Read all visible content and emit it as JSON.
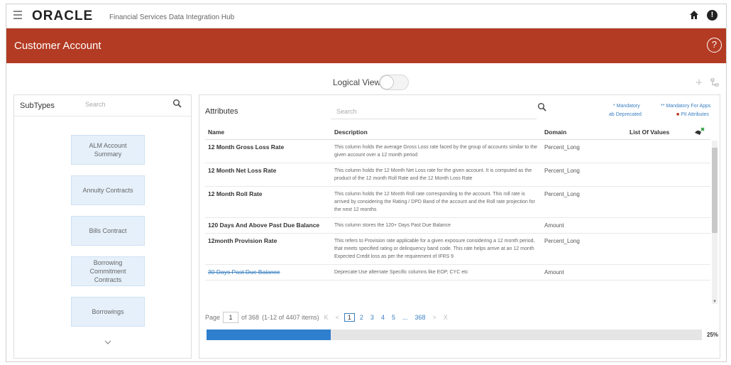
{
  "app": {
    "logo": "ORACLE",
    "product": "Financial Services Data Integration Hub",
    "page_title": "Customer Account"
  },
  "toolbar": {
    "logical_view_label": "Logical View",
    "logical_view_on": false
  },
  "subtypes": {
    "label": "SubTypes",
    "search_placeholder": "Search",
    "items": [
      "ALM Account Summary",
      "Annuity Contracts",
      "Bills Contract",
      "Borrowing Commitment Contracts",
      "Borrowings"
    ]
  },
  "attributes": {
    "label": "Attributes",
    "search_placeholder": "Search",
    "legend": {
      "mandatory": "* Mandatory",
      "deprecated": "ab Deprecated",
      "mandatory_apps": "** Mandatory For Apps",
      "pii": "PII Attributes"
    },
    "columns": [
      "Name",
      "Description",
      "Domain",
      "List Of Values"
    ],
    "rows": [
      {
        "name": "12 Month Gross Loss Rate",
        "description": "This column holds the average Gross Loss rate faced by the group of accounts similar to the given account over a 12 month period",
        "domain": "Percent_Long",
        "deprecated": false
      },
      {
        "name": "12 Month Net Loss Rate",
        "description": "This column holds the 12 Month Net Loss rate for the given account. It is computed as the product of the 12 month Roll Rate and the 12 Month Loss Rate",
        "domain": "Percent_Long",
        "deprecated": false
      },
      {
        "name": "12 Month Roll Rate",
        "description": "This column holds the 12 Month Roll rate corresponding to the account. This roll rate is arrived by considering the Rating / DPD Band of the account and the Roll rate projection for the next 12 months",
        "domain": "Percent_Long",
        "deprecated": false
      },
      {
        "name": "120 Days And Above Past Due Balance",
        "description": "This column stores the 120+ Days Past Due Balance",
        "domain": "Amount",
        "deprecated": false
      },
      {
        "name": "12month Provision Rate",
        "description": "This refers to Provision rate applicable for a given exposure considering a 12 month period, that meets specified rating or delinquency band code. This rate helps arrive at an 12 month Expected Credit loss as per the requirement of IFRS 9",
        "domain": "Percent_Long",
        "deprecated": false
      },
      {
        "name": "30 Days Past Due Balance",
        "description": "Deprecate:Use alternate Specific columns like EOP, CYC etc",
        "domain": "Amount",
        "deprecated": true
      }
    ]
  },
  "pagination": {
    "page_label": "Page",
    "page_value": "1",
    "of_text": "of 368",
    "range_text": "(1-12 of 4407 items)",
    "first": "K",
    "prev": "<",
    "pages": [
      "1",
      "2",
      "3",
      "4",
      "5",
      "...",
      "368"
    ],
    "next": ">",
    "last": "X"
  },
  "progress": {
    "value": 25,
    "label": "25%"
  },
  "colors": {
    "brand": "#b33b23",
    "accent": "#2f7fcf",
    "card": "#e5f0fa"
  }
}
